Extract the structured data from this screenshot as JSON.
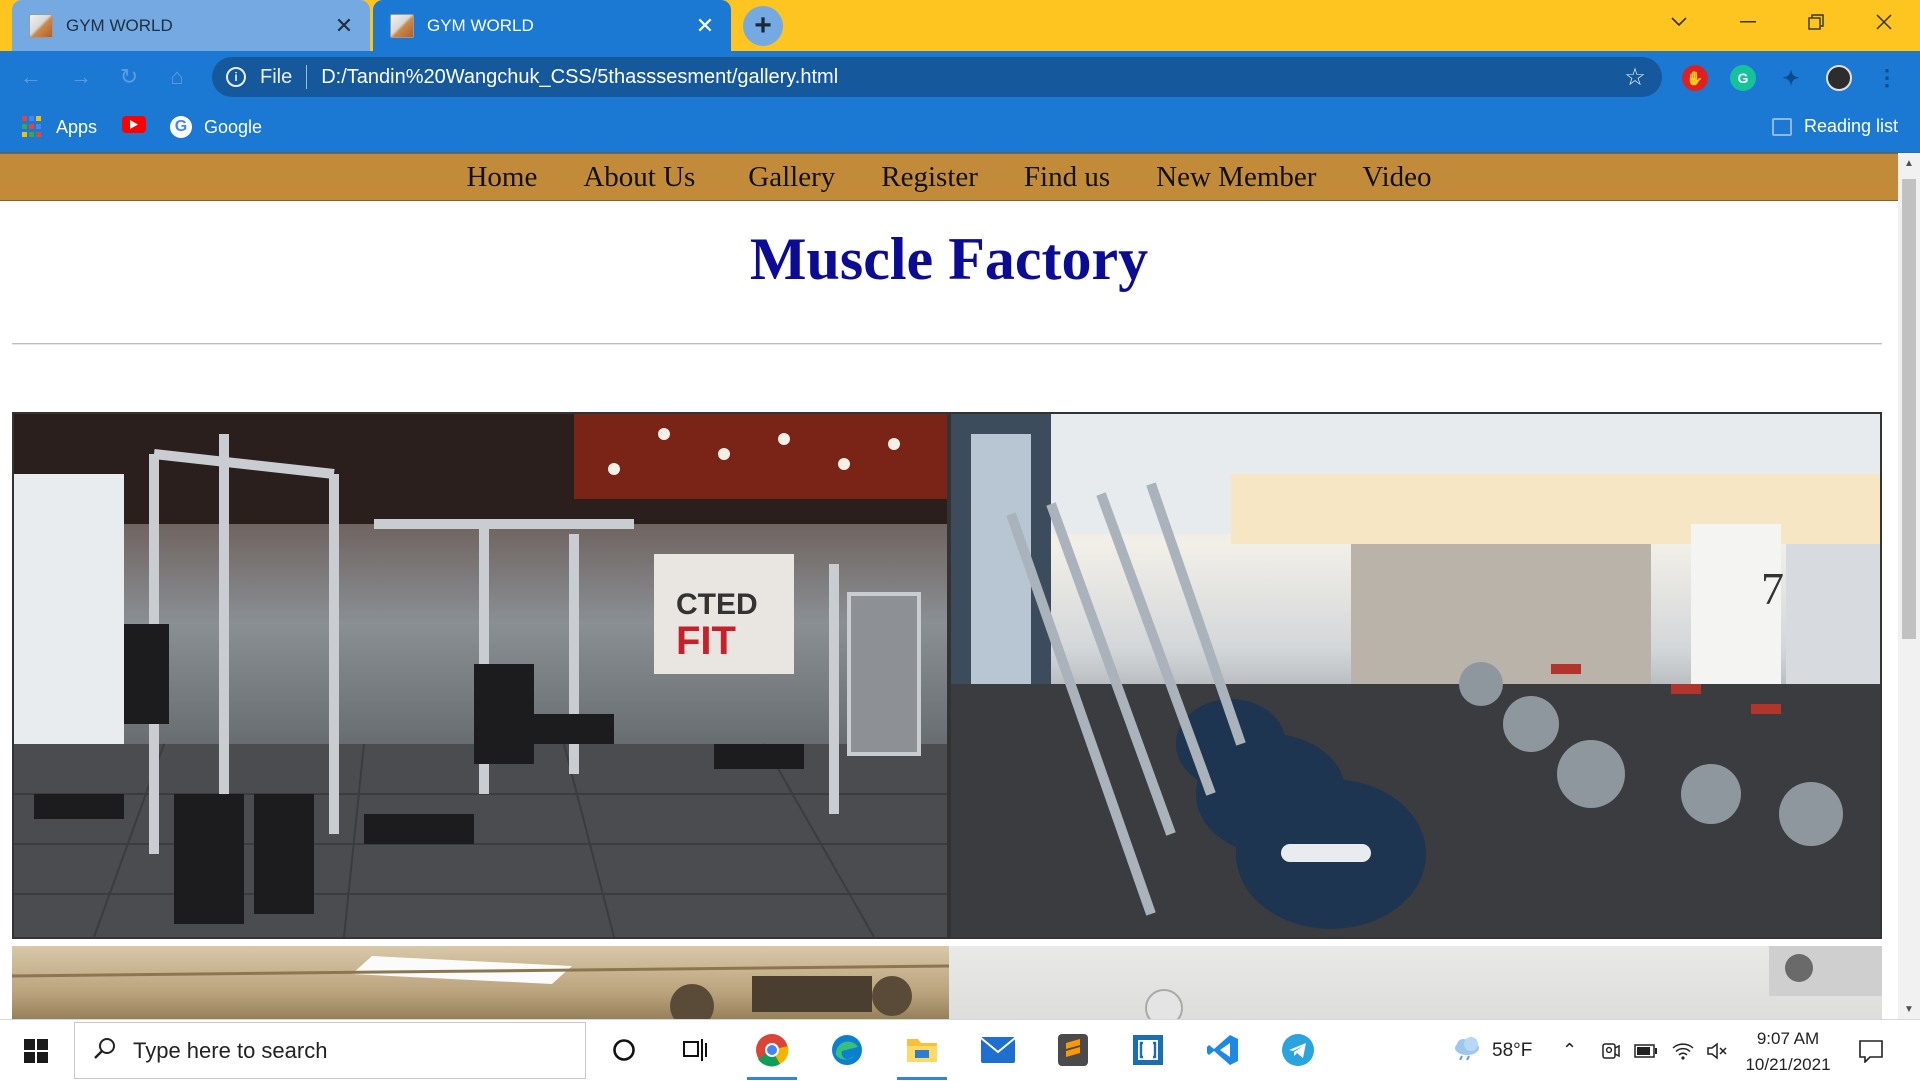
{
  "browser": {
    "tabs": [
      {
        "title": "GYM WORLD",
        "active": false
      },
      {
        "title": "GYM WORLD",
        "active": true
      }
    ],
    "new_tab_label": "+",
    "address": {
      "scheme": "File",
      "url": "D:/Tandin%20Wangchuk_CSS/5thasssesment/gallery.html"
    },
    "bookmarks": [
      {
        "label": "Apps",
        "icon": "apps-grid-icon"
      },
      {
        "label": "",
        "icon": "youtube-icon"
      },
      {
        "label": "Google",
        "icon": "google-icon"
      }
    ],
    "reading_list_label": "Reading list",
    "colors": {
      "tab_strip": "#fec420",
      "toolbar": "#1b79d3"
    }
  },
  "site": {
    "nav": [
      "Home",
      "About Us",
      "Gallery",
      "Register",
      "Find us",
      "New Member",
      "Video"
    ],
    "title": "Muscle Factory",
    "nav_color": "#c28b3a",
    "title_color": "#0b0b93"
  },
  "gallery": {
    "images": [
      {
        "icon": "gym-weight-machines-photo"
      },
      {
        "icon": "gym-cardio-machines-photo"
      },
      {
        "icon": "gym-ceiling-photo"
      },
      {
        "icon": "gym-wall-clock-photo"
      }
    ]
  },
  "taskbar": {
    "search_placeholder": "Type here to search",
    "apps": [
      "task-view-icon",
      "chrome-icon",
      "edge-icon",
      "file-explorer-icon",
      "mail-icon",
      "sublime-text-icon",
      "brackets-icon",
      "vscode-icon",
      "telegram-icon"
    ],
    "weather": "58°F",
    "time": "9:07 AM",
    "date": "10/21/2021"
  }
}
